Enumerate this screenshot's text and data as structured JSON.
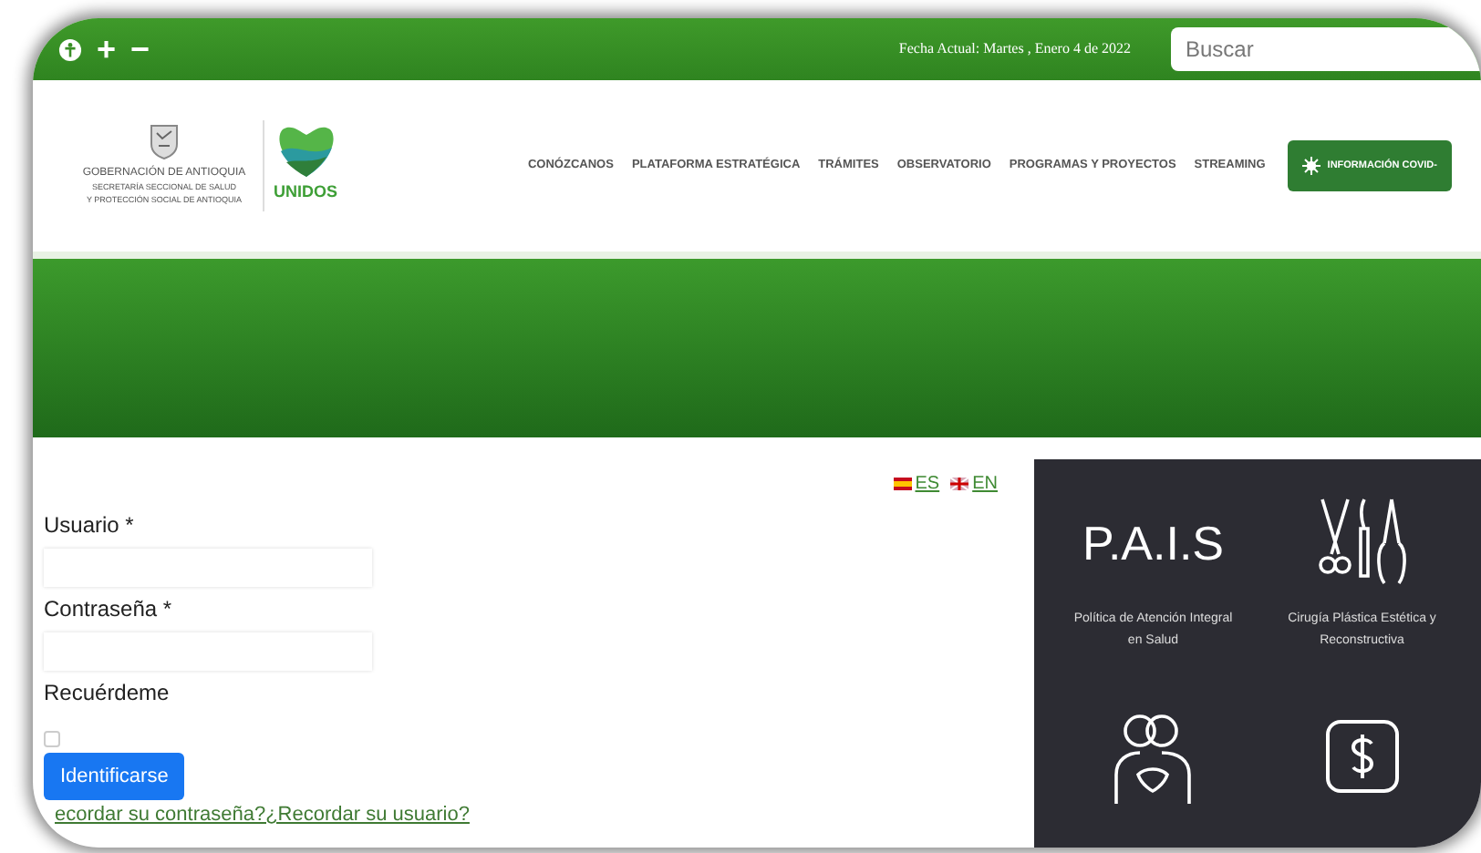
{
  "top_bar": {
    "controls": [
      "+",
      "−"
    ],
    "date": "Fecha Actual: Martes , Enero 4  de 2022",
    "search": {
      "placeholder": "Buscar"
    }
  },
  "header": {
    "logo": {
      "name": "GOBERNACIÓN DE ANTIOQUIA",
      "subtitle_1": "SECRETARÍA SECCIONAL DE SALUD",
      "subtitle_2": "Y PROTECCIÓN SOCIAL DE ANTIOQUIA",
      "brand": "UNIDOS"
    },
    "nav": [
      "CONÓZCANOS",
      "PLATAFORMA ESTRATÉGICA",
      "TRÁMITES",
      "OBSERVATORIO",
      "PROGRAMAS Y PROYECTOS",
      "STREAMING"
    ],
    "covid_button": "INFORMACIÓN COVID-"
  },
  "languages": [
    {
      "code": "ES",
      "kind": "es"
    },
    {
      "code": "EN",
      "kind": "en"
    }
  ],
  "login": {
    "username_label": "Usuario *",
    "password_label": "Contraseña *",
    "remember_label": "Recuérdeme",
    "remember_checked": false,
    "submit": "Identificarse",
    "recover_link": "ecordar su contraseña?¿Recordar su usuario?"
  },
  "services": [
    {
      "kind": "text",
      "heading": "P.A.I.S",
      "caption": "Política de Atención Integral en Salud"
    },
    {
      "kind": "tools",
      "caption": "Cirugía Plástica Estética y Reconstructiva"
    },
    {
      "kind": "people"
    },
    {
      "kind": "money"
    }
  ]
}
